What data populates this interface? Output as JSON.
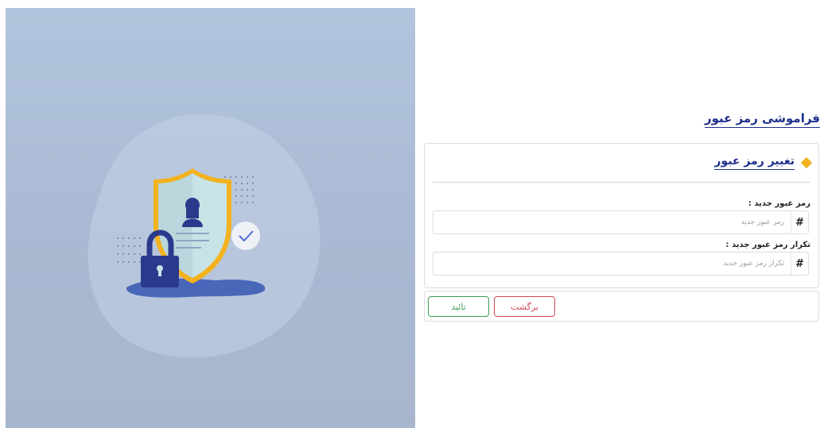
{
  "page": {
    "title": "فراموشی رمز عبور"
  },
  "card": {
    "title": "تغییر رمز عبور",
    "fields": [
      {
        "label": "رمز عبور جدید :",
        "placeholder": "رمز عبور جدید",
        "value": "",
        "addon": "#"
      },
      {
        "label": "تکرار رمز عبور جدید :",
        "placeholder": "تکرار رمز عبور جدید",
        "value": "",
        "addon": "#"
      }
    ]
  },
  "actions": {
    "back_label": "برگشت",
    "confirm_label": "تائید"
  },
  "illustration": {
    "icons": [
      "shield-icon",
      "padlock-icon",
      "user-silhouette-icon",
      "checkmark-badge-icon"
    ]
  },
  "colors": {
    "panel_bg": "#aebfd8",
    "title_blue": "#1e2f8c",
    "accent_yellow": "#f2b21d",
    "confirm_green": "#3f9b5a",
    "back_red": "#cf4a57"
  }
}
